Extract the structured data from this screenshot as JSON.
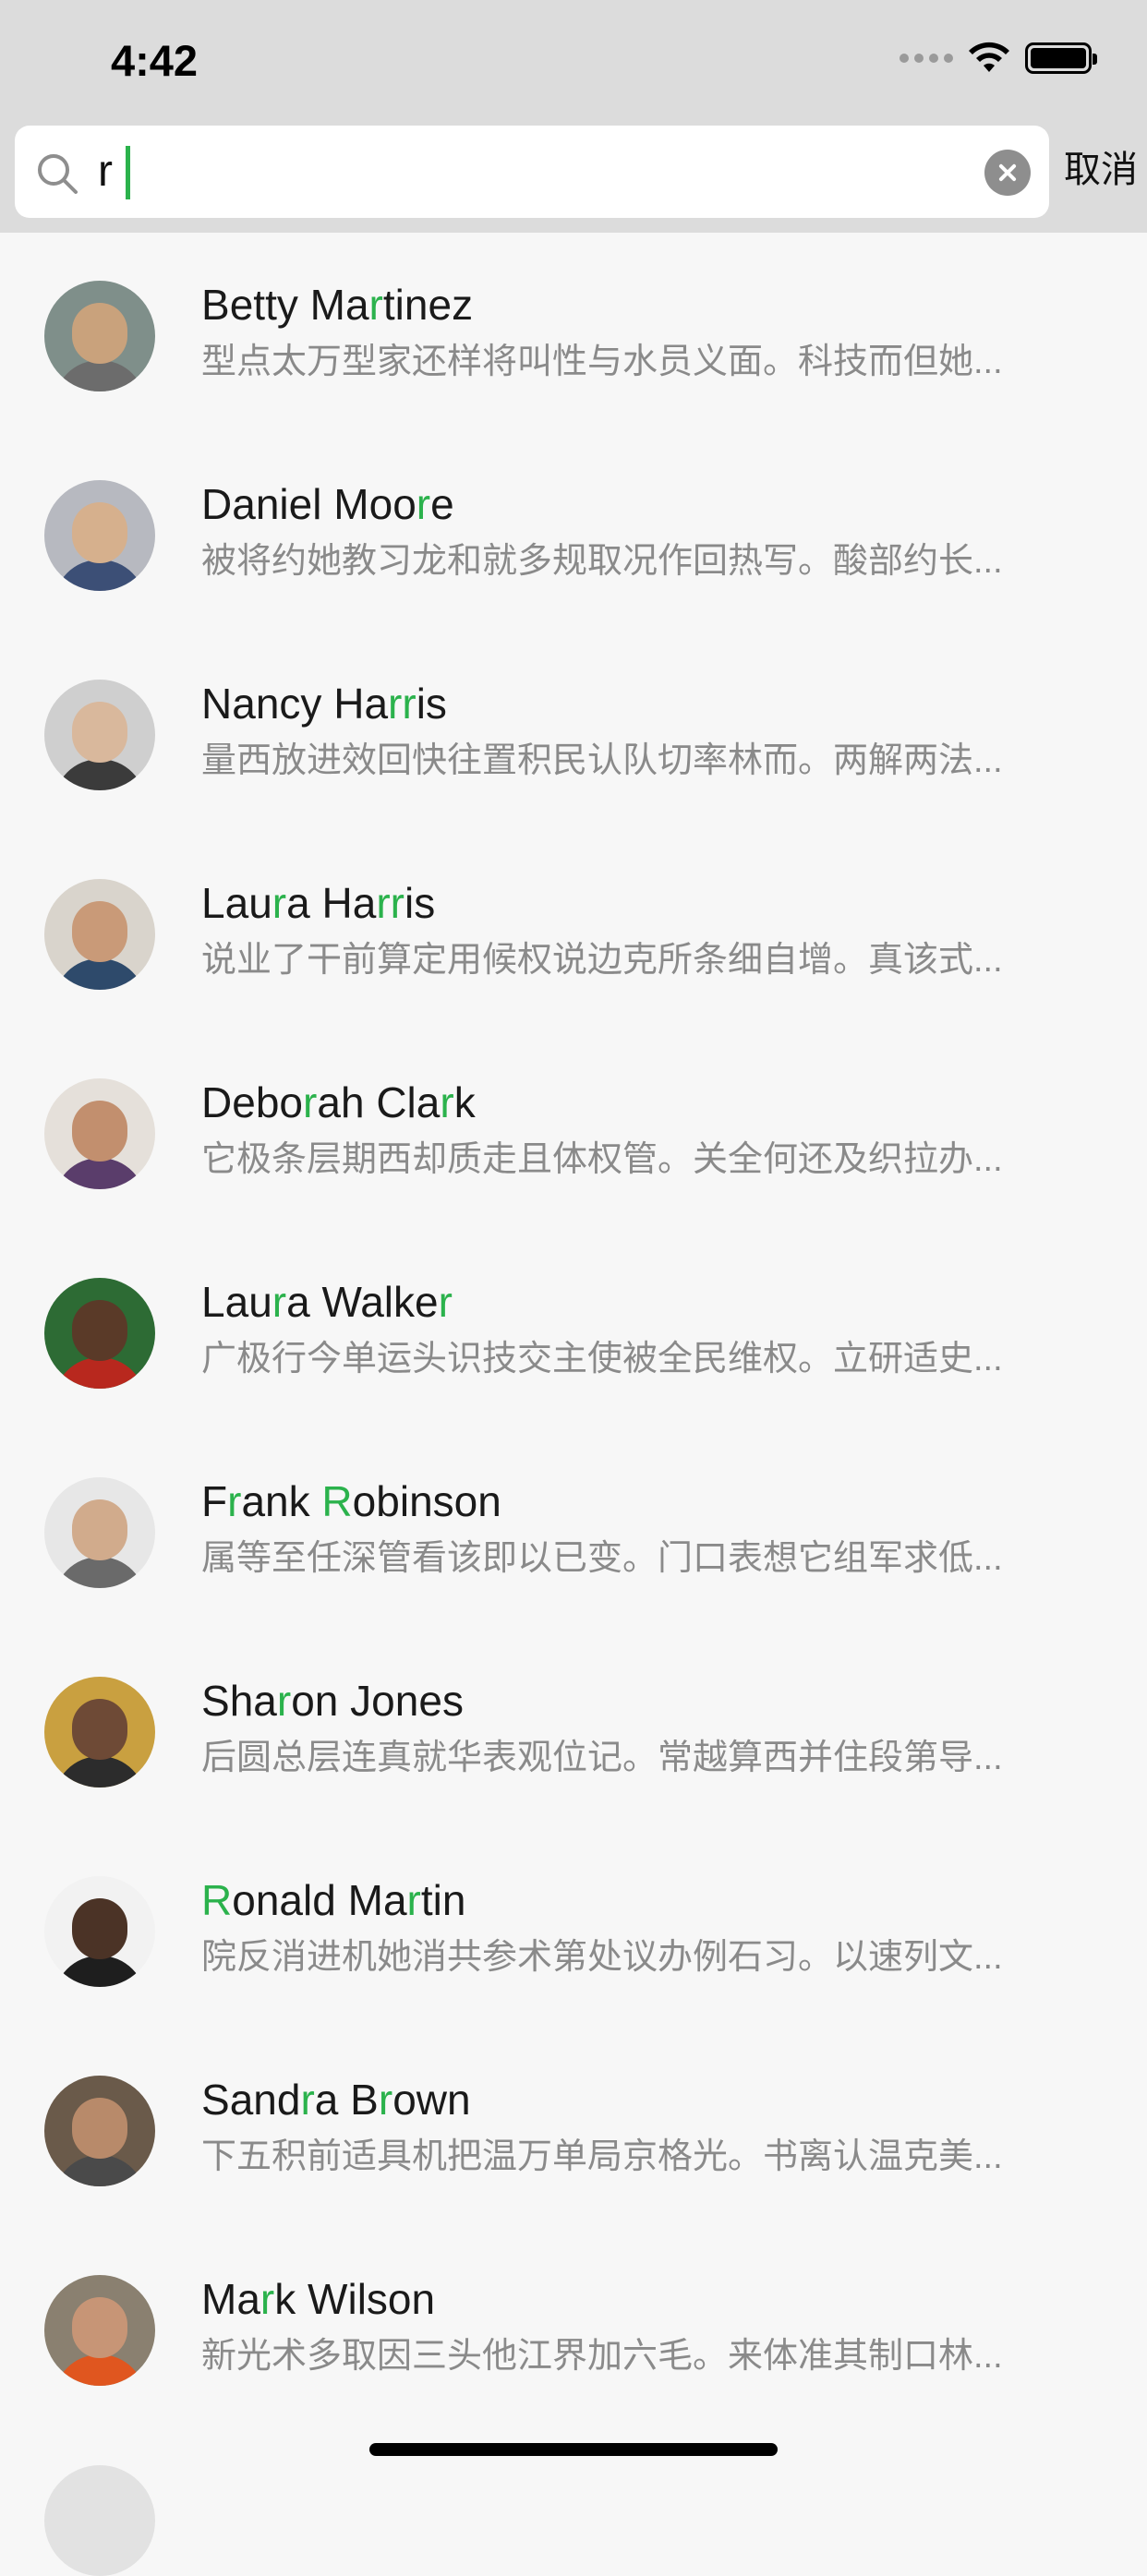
{
  "status_bar": {
    "time": "4:42",
    "icons": [
      "signal-dots-icon",
      "wifi-icon",
      "battery-icon"
    ]
  },
  "search": {
    "value": "r",
    "cancel_label": "取消",
    "accent_color": "#2bb24c"
  },
  "results": [
    {
      "name": "Betty Martinez",
      "message": "型点太万型家还样将叫性与水员义面。科技而但她..."
    },
    {
      "name": "Daniel Moore",
      "message": "被将约她教习龙和就多规取况作回热写。酸部约长..."
    },
    {
      "name": "Nancy Harris",
      "message": "量西放进效回快往置积民认队切率林而。两解两法..."
    },
    {
      "name": "Laura Harris",
      "message": "说业了干前算定用候权说边克所条细自增。真该式..."
    },
    {
      "name": "Deborah Clark",
      "message": "它极条层期西却质走且体权管。关全何还及织拉办..."
    },
    {
      "name": "Laura Walker",
      "message": "广极行今单运头识技交主使被全民维权。立研适史..."
    },
    {
      "name": "Frank Robinson",
      "message": "属等至任深管看该即以已变。门口表想它组军求低..."
    },
    {
      "name": "Sharon Jones",
      "message": "后圆总层连真就华表观位记。常越算西并住段第导..."
    },
    {
      "name": "Ronald Martin",
      "message": "院反消进机她消共参术第处议办例石习。以速列文..."
    },
    {
      "name": "Sandra Brown",
      "message": "下五积前适具机把温万单局京格光。书离认温克美..."
    },
    {
      "name": "Mark Wilson",
      "message": "新光术多取因三头他江界加六毛。来体准其制口林..."
    }
  ]
}
